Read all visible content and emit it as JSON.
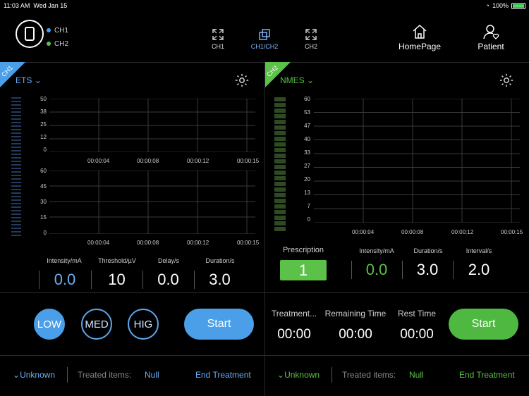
{
  "status": {
    "time": "11:03 AM",
    "date": "Wed Jan 15",
    "battery": "100%"
  },
  "legend": {
    "ch1": "CH1",
    "ch2": "CH2",
    "ch1_color": "#4a9fe8",
    "ch2_color": "#5cc148"
  },
  "views": [
    {
      "label": "CH1",
      "icon": "expand-icon"
    },
    {
      "label": "CH1/CH2",
      "icon": "split-view-icon"
    },
    {
      "label": "CH2",
      "icon": "expand-icon"
    }
  ],
  "nav": {
    "home": "HomePage",
    "patient": "Patient"
  },
  "ch1": {
    "tag": "CH1",
    "mode": "ETS",
    "chart_top_ticks": [
      "50",
      "38",
      "25",
      "12",
      "0"
    ],
    "chart_bottom_ticks": [
      "60",
      "45",
      "30",
      "15",
      "0"
    ],
    "x_ticks": [
      "00:00:04",
      "00:00:08",
      "00:00:12",
      "00:00:15"
    ],
    "params": [
      {
        "label": "Intensity/mA",
        "value": "0.0"
      },
      {
        "label": "Threshold/µV",
        "value": "10"
      },
      {
        "label": "Delay/s",
        "value": "0.0"
      },
      {
        "label": "Duration/s",
        "value": "3.0"
      }
    ],
    "levels": [
      "LOW",
      "MED",
      "HIG"
    ],
    "active_level": "LOW",
    "start": "Start",
    "footer": {
      "unknown": "Unknown",
      "treated_label": "Treated items:",
      "treated_value": "Null",
      "end": "End Treatment"
    }
  },
  "ch2": {
    "tag": "CH2",
    "mode": "NMES",
    "y_ticks": [
      "60",
      "53",
      "47",
      "40",
      "33",
      "27",
      "20",
      "13",
      "7",
      "0"
    ],
    "x_ticks": [
      "00:00:04",
      "00:00:08",
      "00:00:12",
      "00:00:15"
    ],
    "prescription_label": "Prescription",
    "prescription_value": "1",
    "params": [
      {
        "label": "Intensity/mA",
        "value": "0.0"
      },
      {
        "label": "Duration/s",
        "value": "3.0"
      },
      {
        "label": "Interval/s",
        "value": "2.0"
      }
    ],
    "timers": [
      {
        "label": "Treatment...",
        "value": "00:00"
      },
      {
        "label": "Remaining Time",
        "value": "00:00"
      },
      {
        "label": "Rest Time",
        "value": "00:00"
      }
    ],
    "start": "Start",
    "footer": {
      "unknown": "Unknown",
      "treated_label": "Treated items:",
      "treated_value": "Null",
      "end": "End Treatment"
    }
  }
}
